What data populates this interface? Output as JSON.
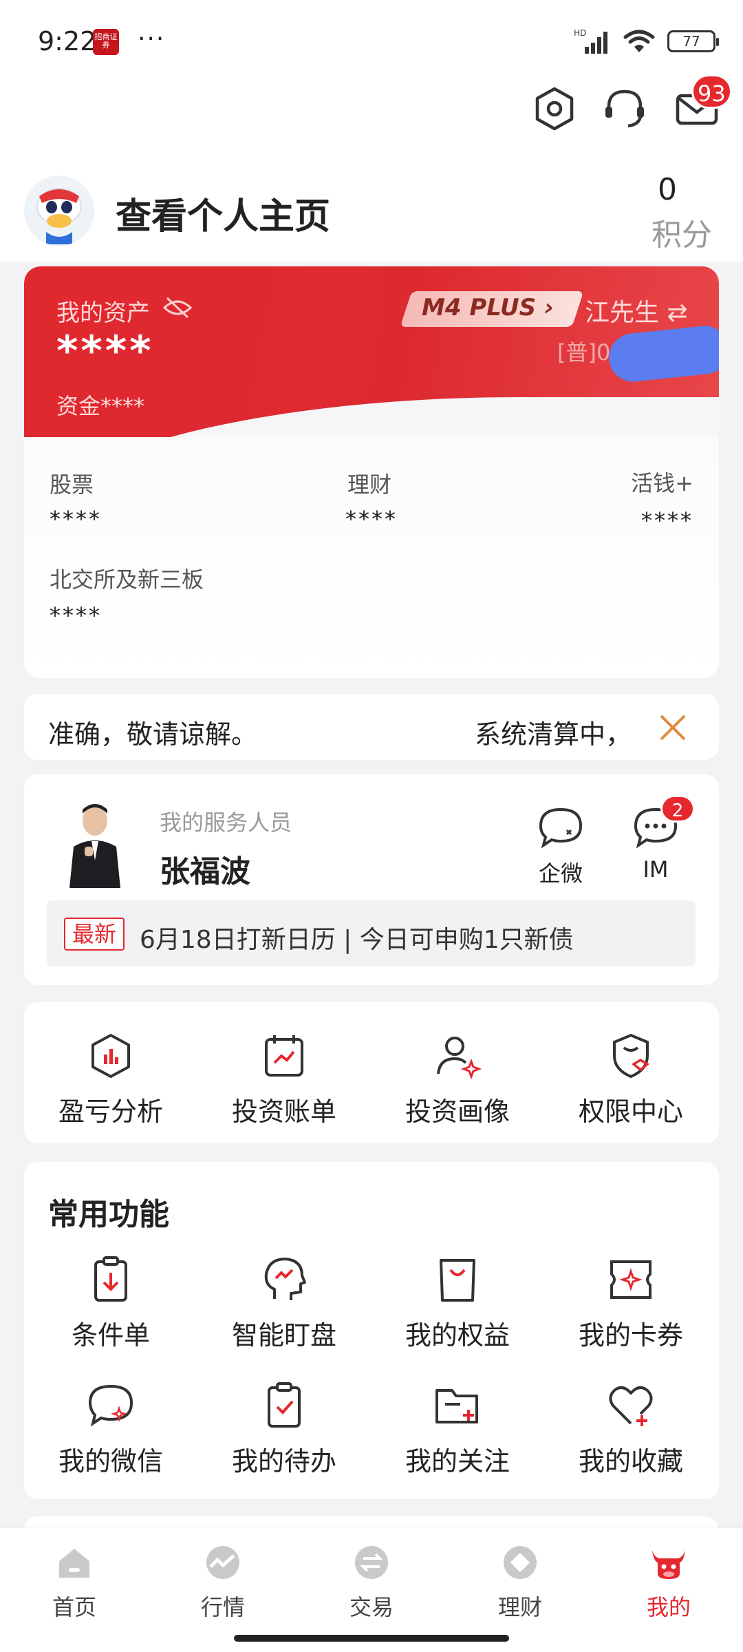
{
  "status": {
    "time": "9:22",
    "app_icon_text": "招商证券",
    "more": "···",
    "network": "HD",
    "battery": "77"
  },
  "header": {
    "mail_badge": "93"
  },
  "profile": {
    "link_label": "查看个人主页",
    "points_value": "0",
    "points_label": "积分"
  },
  "asset": {
    "label": "我的资产",
    "value": "****",
    "funds_label": "资金",
    "funds_value": "****",
    "level_badge": "M4 PLUS",
    "user_name": "江先生",
    "account": "[普]05",
    "items": [
      {
        "label": "股票",
        "value": "****"
      },
      {
        "label": "理财",
        "value": "****"
      },
      {
        "label": "活钱+",
        "value": "****"
      },
      {
        "label": "北交所及新三板",
        "value": "****"
      }
    ]
  },
  "notice": {
    "text_left": "准确，敬请谅解。",
    "text_right": "系统清算中，"
  },
  "service": {
    "label": "我的服务人员",
    "name": "张福波",
    "wecom_label": "企微",
    "im_label": "IM",
    "im_badge": "2",
    "news_tag": "最新",
    "news_text": "6月18日打新日历 | 今日可申购1只新债"
  },
  "tools": [
    {
      "label": "盈亏分析",
      "icon": "profit-loss-icon"
    },
    {
      "label": "投资账单",
      "icon": "bill-icon"
    },
    {
      "label": "投资画像",
      "icon": "portrait-icon"
    },
    {
      "label": "权限中心",
      "icon": "permission-icon"
    }
  ],
  "common": {
    "title": "常用功能",
    "row1": [
      {
        "label": "条件单",
        "icon": "condition-order-icon"
      },
      {
        "label": "智能盯盘",
        "icon": "smart-watch-icon"
      },
      {
        "label": "我的权益",
        "icon": "rights-icon"
      },
      {
        "label": "我的卡券",
        "icon": "coupon-icon"
      }
    ],
    "row2": [
      {
        "label": "我的微信",
        "icon": "wechat-icon"
      },
      {
        "label": "我的待办",
        "icon": "todo-icon"
      },
      {
        "label": "我的关注",
        "icon": "follow-folder-icon"
      },
      {
        "label": "我的收藏",
        "icon": "favorite-heart-icon"
      }
    ]
  },
  "nav": [
    {
      "label": "首页",
      "icon": "home-icon"
    },
    {
      "label": "行情",
      "icon": "market-icon"
    },
    {
      "label": "交易",
      "icon": "trade-icon"
    },
    {
      "label": "理财",
      "icon": "wealth-icon"
    },
    {
      "label": "我的",
      "icon": "mine-bull-icon"
    }
  ],
  "colors": {
    "brand_red": "#e5282e",
    "accent_red": "#dd2a30",
    "bg": "#f3f3f5"
  }
}
